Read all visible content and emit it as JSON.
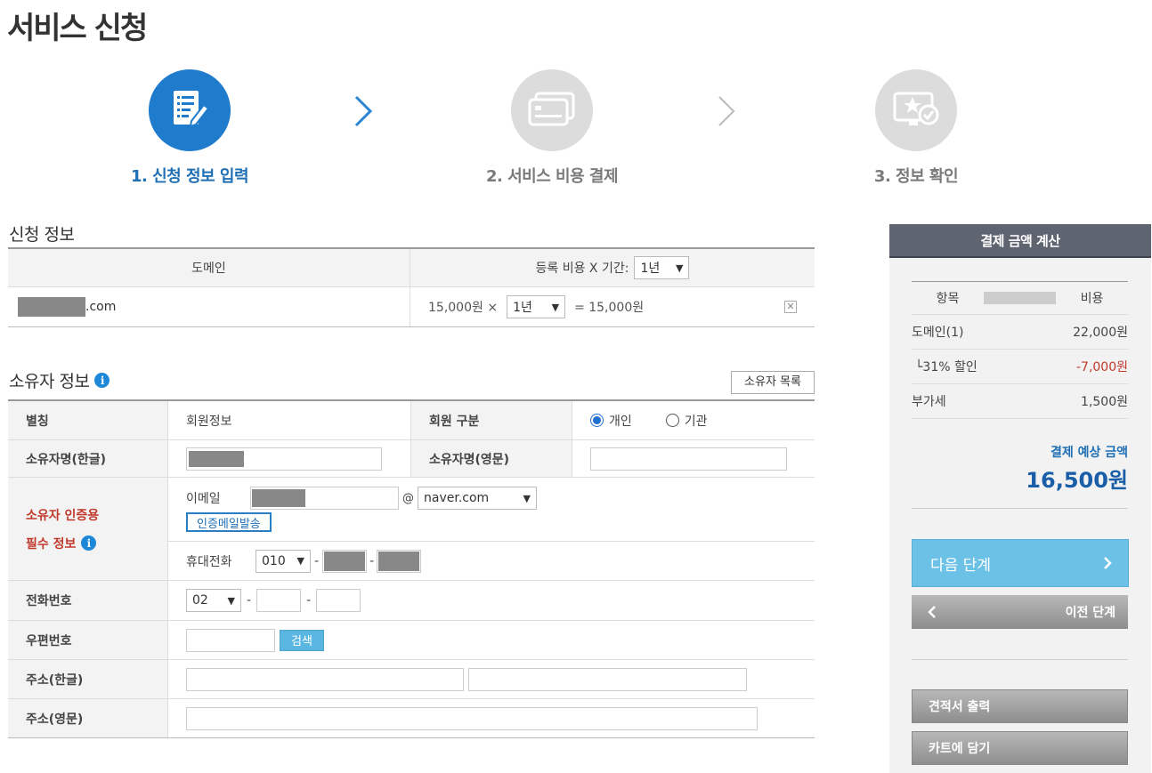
{
  "page": {
    "title": "서비스 신청"
  },
  "steps": [
    {
      "label": "1. 신청 정보 입력"
    },
    {
      "label": "2. 서비스 비용 결제"
    },
    {
      "label": "3. 정보 확인"
    }
  ],
  "application": {
    "heading": "신청 정보",
    "col_domain": "도메인",
    "col_fee": "등록 비용 X 기간:",
    "period_header_select": "1년",
    "domain_suffix": ".com",
    "unit_price": "15,000원 ×",
    "row_period": "1년",
    "row_total": "= 15,000원",
    "remove_glyph": "✕"
  },
  "owner": {
    "heading": "소유자 정보",
    "list_button": "소유자 목록",
    "alias_label": "별칭",
    "alias_value": "회원정보",
    "member_type_label": "회원 구분",
    "type_personal": "개인",
    "type_org": "기관",
    "name_kr_label": "소유자명(한글)",
    "name_en_label": "소유자명(영문)",
    "auth_label_1": "소유자 인증용",
    "auth_label_2": "필수 정보",
    "email_label": "이메일",
    "at": "@",
    "email_domain": "naver.com",
    "send_mail_button": "인증메일발송",
    "mobile_label": "휴대전화",
    "mobile_prefix": "010",
    "dash": "-",
    "phone_label": "전화번호",
    "phone_prefix": "02",
    "zip_label": "우편번호",
    "search_button": "검색",
    "addr_kr_label": "주소(한글)",
    "addr_en_label": "주소(영문)"
  },
  "panel": {
    "title": "결제 금액 계산",
    "col_item": "항목",
    "col_cost": "비용",
    "rows": [
      {
        "label": "도메인(1)",
        "value": "22,000원"
      },
      {
        "label": "└31% 할인",
        "value": "-7,000원"
      },
      {
        "label": "부가세",
        "value": "1,500원"
      }
    ],
    "estimate_label": "결제 예상 금액",
    "estimate_value": "16,500원",
    "next_button": "다음 단계",
    "prev_button": "이전 단계",
    "quote_button": "견적서 출력",
    "cart_button": "카트에 담기"
  },
  "colors": {
    "accent": "#1f7ccc",
    "panel_header": "#5e6470",
    "next_button": "#6cc1e6",
    "discount": "#c0392b"
  }
}
